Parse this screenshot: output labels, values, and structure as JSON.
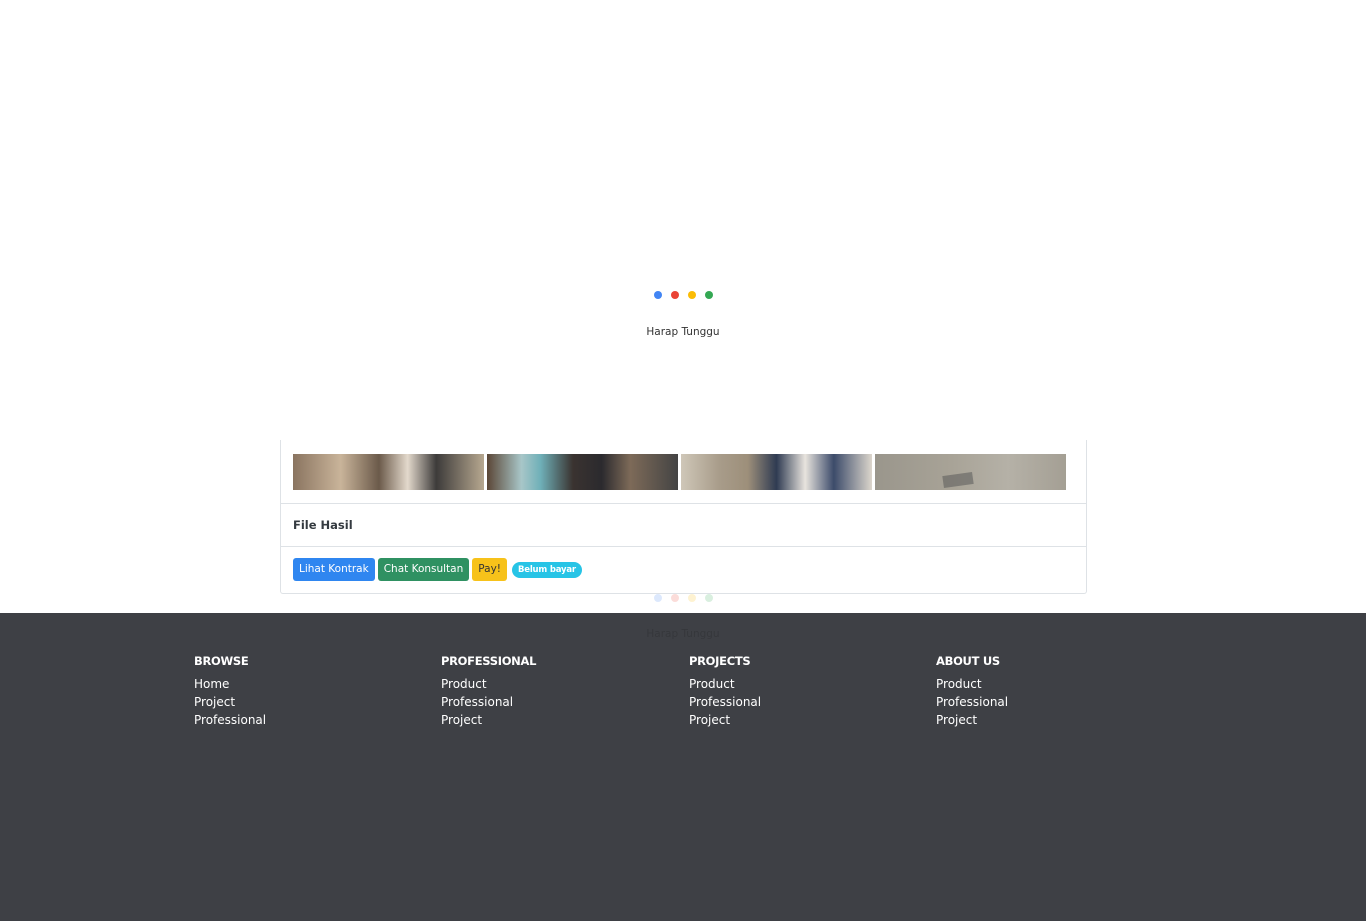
{
  "loader": {
    "text": "Harap Tunggu",
    "dot_colors": [
      "#4285f4",
      "#ea4335",
      "#fbbc05",
      "#34a853"
    ]
  },
  "card": {
    "file_title": "File Hasil",
    "buttons": {
      "contract": "Lihat Kontrak",
      "chat": "Chat Konsultan",
      "pay": "Pay!"
    },
    "status_badge": "Belum bayar"
  },
  "footer": {
    "columns": [
      {
        "title": "BROWSE",
        "links": [
          "Home",
          "Project",
          "Professional"
        ]
      },
      {
        "title": "PROFESSIONAL",
        "links": [
          "Product",
          "Professional",
          "Project"
        ]
      },
      {
        "title": "PROJECTS",
        "links": [
          "Product",
          "Professional",
          "Project"
        ]
      },
      {
        "title": "ABOUT US",
        "links": [
          "Product",
          "Professional",
          "Project"
        ]
      }
    ]
  },
  "colors": {
    "primary": "#2f86f0",
    "success": "#2f9162",
    "warning": "#f7c21a",
    "info": "#27c4e6",
    "footer_bg": "#3e4045"
  }
}
